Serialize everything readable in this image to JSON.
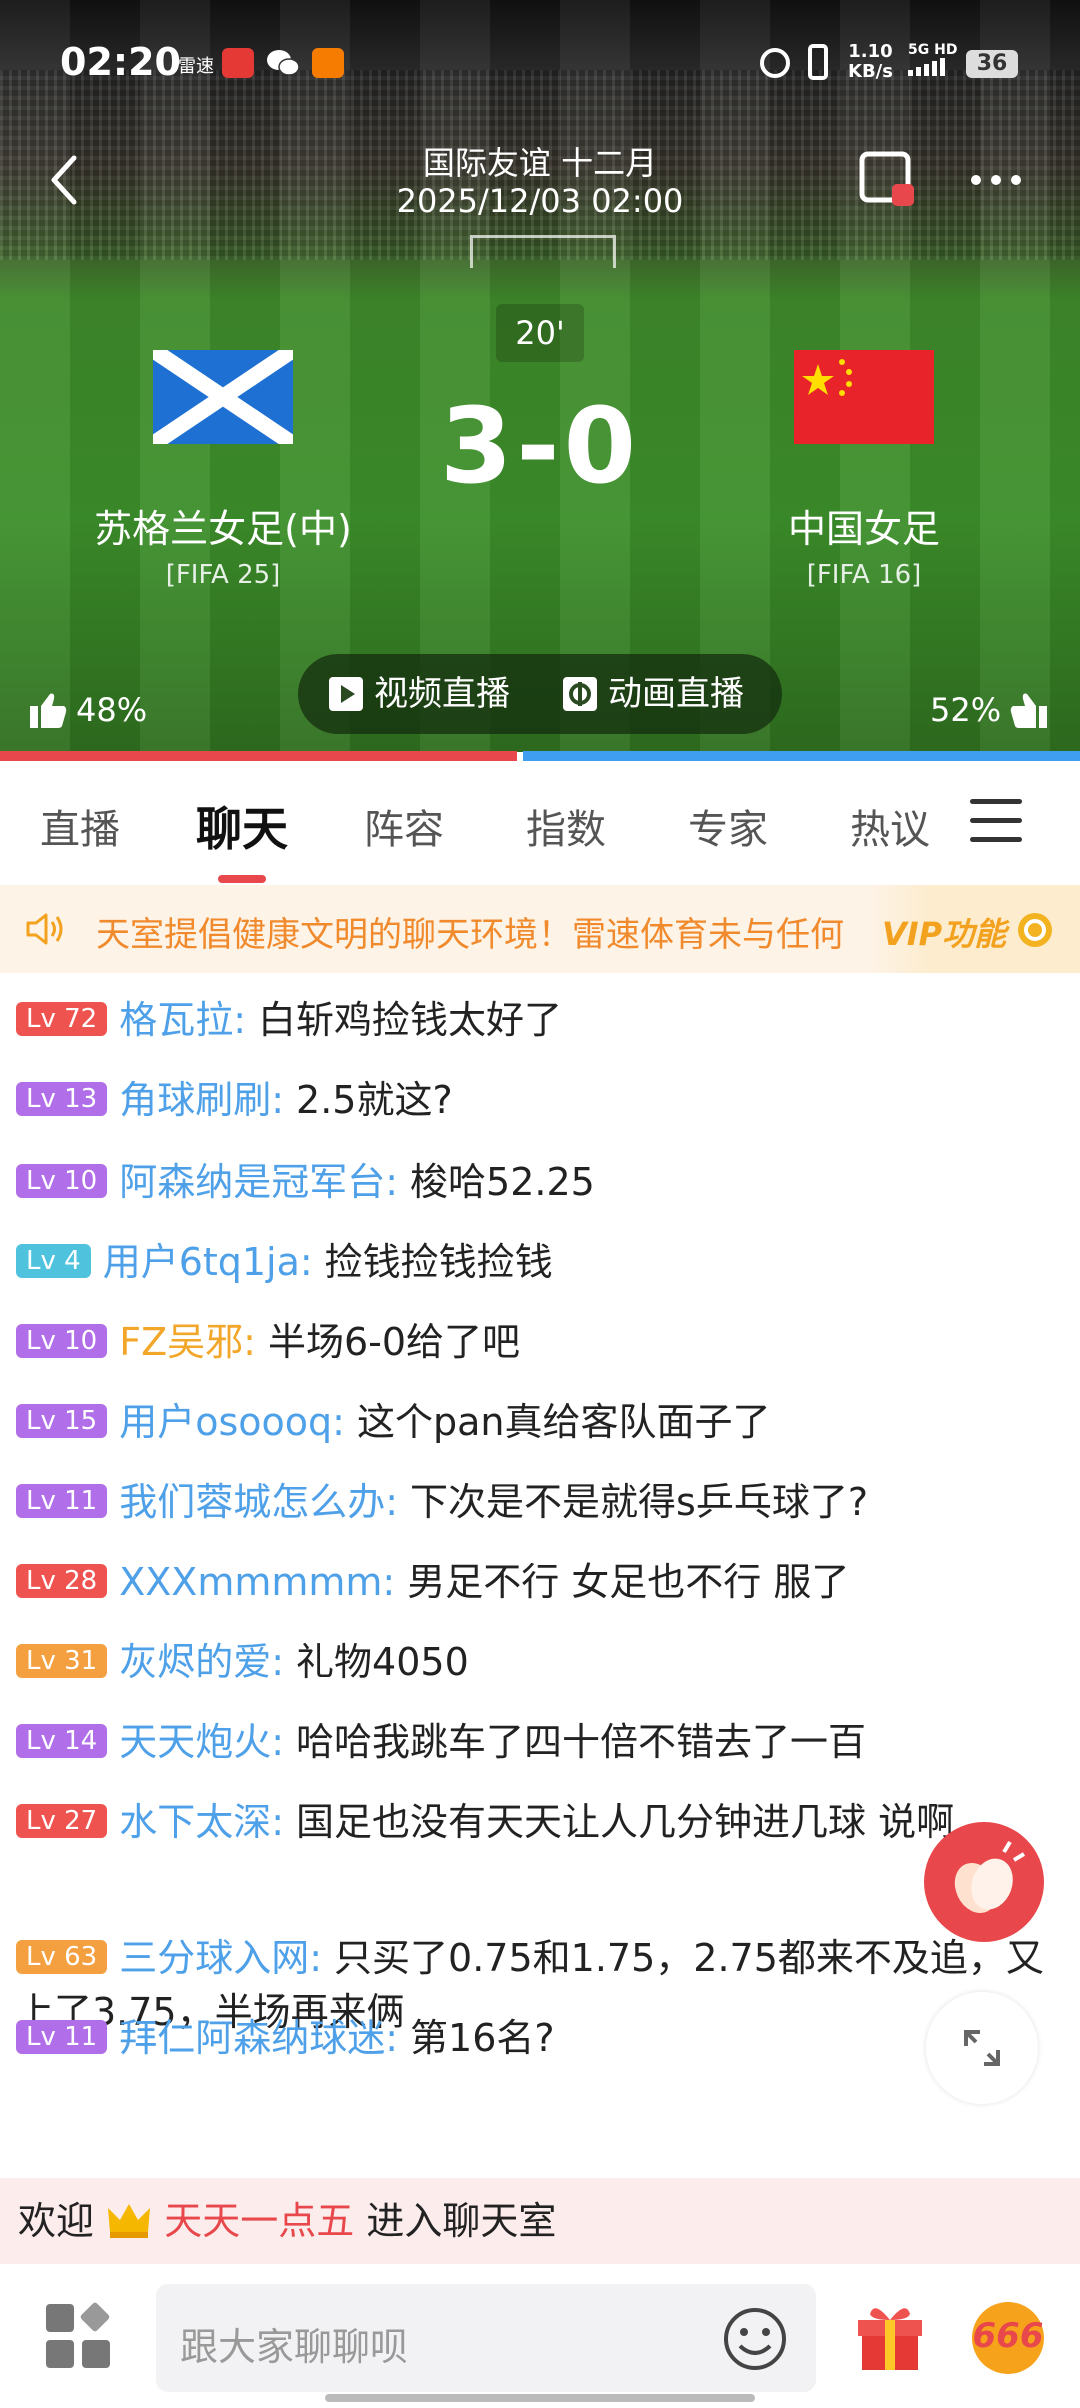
{
  "status_bar": {
    "time": "02:20",
    "carrier_text": "雷速",
    "net_speed": "1.10\nKB/s",
    "net_speed_top": "1.10",
    "net_speed_bottom": "KB/s",
    "signal_label": "5G HD",
    "battery": "36"
  },
  "header": {
    "league": "国际友谊 十二月",
    "datetime": "2025/12/03 02:00"
  },
  "match": {
    "minute": "20'",
    "score": "3-0",
    "home": {
      "name": "苏格兰女足(中)",
      "rating": "[FIFA 25]"
    },
    "away": {
      "name": "中国女足",
      "rating": "[FIFA 16]"
    }
  },
  "live_buttons": {
    "video": "视频直播",
    "animation": "动画直播"
  },
  "support": {
    "home_pct": "48%",
    "away_pct": "52%",
    "home_fraction": 0.48
  },
  "tabs": [
    "直播",
    "聊天",
    "阵容",
    "指数",
    "专家",
    "热议"
  ],
  "notice": {
    "text": "天室提倡健康文明的聊天环境！雷速体育未与任何",
    "vip": "VIP功能"
  },
  "messages": [
    {
      "level": "Lv 72",
      "user": "格瓦拉:",
      "text": "白斩鸡捡钱太好了",
      "lv_color": "#ef5350",
      "user_color": "#4ea0e8"
    },
    {
      "level": "Lv 13",
      "user": "角球刷刷:",
      "text": "2.5就这?",
      "lv_color": "#b06ee8",
      "user_color": "#4ea0e8"
    },
    {
      "level": "Lv 10",
      "user": "阿森纳是冠军台:",
      "text": "梭哈52.25",
      "lv_color": "#b06ee8",
      "user_color": "#4ea0e8"
    },
    {
      "level": "Lv 4",
      "user": "用户6tq1ja:",
      "text": "捡钱捡钱捡钱",
      "lv_color": "#4fc3dd",
      "user_color": "#4ea0e8"
    },
    {
      "level": "Lv 10",
      "user": "FZ吴邪:",
      "text": "半场6-0给了吧",
      "lv_color": "#b06ee8",
      "user_color": "#f2a72a"
    },
    {
      "level": "Lv 15",
      "user": "用户osoooq:",
      "text": "这个pan真给客队面子了",
      "lv_color": "#b06ee8",
      "user_color": "#4ea0e8"
    },
    {
      "level": "Lv 11",
      "user": "我们蓉城怎么办:",
      "text": "下次是不是就得s乒乓球了?",
      "lv_color": "#b06ee8",
      "user_color": "#4ea0e8"
    },
    {
      "level": "Lv 28",
      "user": "XXXmmmmm:",
      "text": "男足不行 女足也不行 服了",
      "lv_color": "#ef5350",
      "user_color": "#4ea0e8"
    },
    {
      "level": "Lv 31",
      "user": "灰烬的爱:",
      "text": "礼物4050",
      "lv_color": "#f4a040",
      "user_color": "#4ea0e8"
    },
    {
      "level": "Lv 14",
      "user": "天天炮火:",
      "text": "哈哈我跳车了四十倍不错去了一百",
      "lv_color": "#b06ee8",
      "user_color": "#4ea0e8"
    },
    {
      "level": "Lv 27",
      "user": "水下太深:",
      "text": "国足也没有天天让人几分钟进几球 说啊",
      "lv_color": "#ef5350",
      "user_color": "#4ea0e8"
    },
    {
      "level": "Lv 63",
      "user": "三分球入网:",
      "text": "只买了0.75和1.75，2.75都来不及追，又上了3.75，半场再来俩",
      "lv_color": "#f4a040",
      "user_color": "#4ea0e8"
    },
    {
      "level": "Lv 11",
      "user": "拜仁阿森纳球迷:",
      "text": "第16名?",
      "lv_color": "#b06ee8",
      "user_color": "#4ea0e8"
    }
  ],
  "welcome": {
    "prefix": "欢迎",
    "user": "天天一点五",
    "suffix": "进入聊天室"
  },
  "bottom_bar": {
    "placeholder": "跟大家聊聊呗",
    "badge": "666"
  }
}
